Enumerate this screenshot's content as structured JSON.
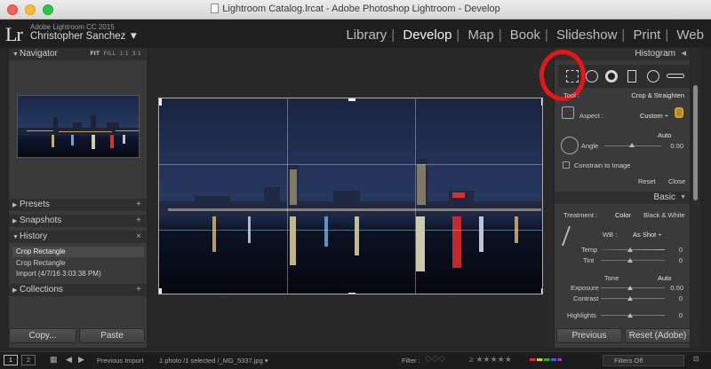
{
  "window": {
    "title": "Lightroom Catalog.lrcat - Adobe Photoshop Lightroom - Develop"
  },
  "identity": {
    "logo": "Lr",
    "app_name": "Adobe Lightroom CC 2015",
    "user": "Christopher Sanchez ▼"
  },
  "modules": [
    {
      "label": "Library",
      "active": false
    },
    {
      "label": "Develop",
      "active": true
    },
    {
      "label": "Map",
      "active": false
    },
    {
      "label": "Book",
      "active": false
    },
    {
      "label": "Slideshow",
      "active": false
    },
    {
      "label": "Print",
      "active": false
    },
    {
      "label": "Web",
      "active": false
    }
  ],
  "left": {
    "navigator": {
      "label": "Navigator",
      "opt_fit": "FIT",
      "opt_fill": "FILL",
      "opt_1": "1:1",
      "opt_3": "3:1"
    },
    "presets": "Presets",
    "snapshots": "Snapshots",
    "history": {
      "label": "History",
      "close": "×",
      "items": [
        "Crop Rectangle",
        "Crop Rectangle",
        "Import (4/7/16 3:03:38 PM)"
      ]
    },
    "collections": "Collections",
    "plus": "+",
    "copy_button": "Copy...",
    "paste_button": "Paste"
  },
  "right": {
    "histogram": "Histogram",
    "tool_label": "Tool :",
    "tool_value": "Crop & Straighten",
    "aspect_label": "Aspect :",
    "aspect_value": "Custom ÷",
    "auto_label": "Auto",
    "angle_label": "Angle",
    "angle_value": "0.00",
    "constrain_label": "Constrain to Image",
    "reset_label": "Reset",
    "close_label": "Close",
    "basic": "Basic",
    "treatment_label": "Treatment :",
    "color_label": "Color",
    "bw_label": "Black & White",
    "wb_label": "WB :",
    "wb_value": "As Shot ÷",
    "temp_label": "Temp",
    "temp_value": "0",
    "tint_label": "Tint",
    "tint_value": "0",
    "tone_label": "Tone",
    "tone_auto": "Auto",
    "exposure_label": "Exposure",
    "exposure_value": "0.00",
    "contrast_label": "Contrast",
    "contrast_value": "0",
    "highlights_label": "Highlights",
    "highlights_value": "0",
    "previous_button": "Previous",
    "reset_adobe_button": "Reset (Adobe)"
  },
  "filmstrip": {
    "page1": "1",
    "page2": "2",
    "previous_import": "Previous Import",
    "info": "1 photo /1 selected /_MG_5337.jpg ▾",
    "filter_label": "Filter :",
    "filters_off": "Filters Off"
  },
  "colors": {
    "accent_red": "#e81717",
    "panel": "#3a3a3a",
    "background": "#262626"
  }
}
